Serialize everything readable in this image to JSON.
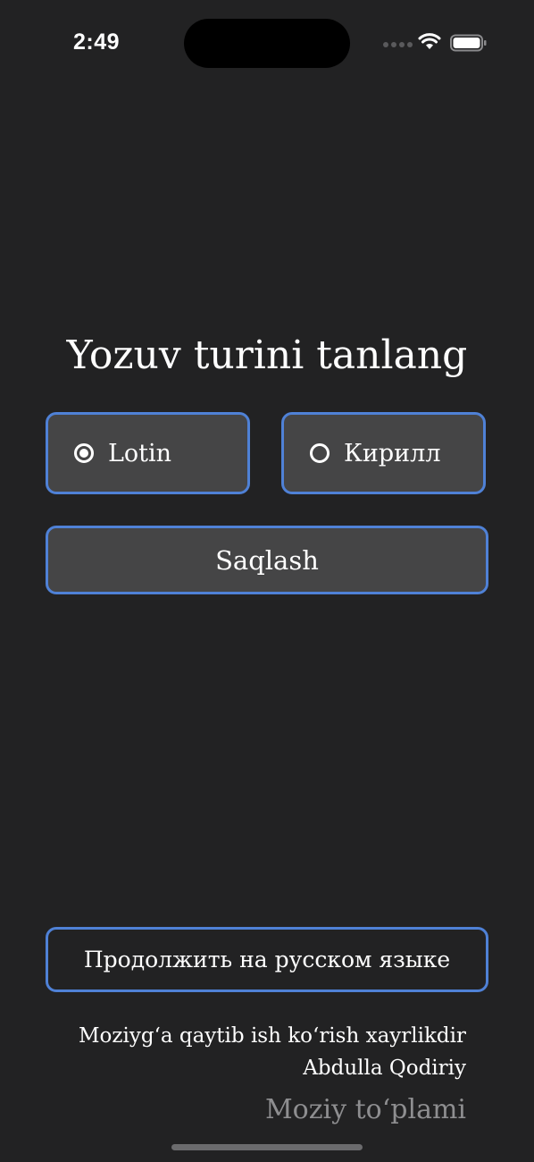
{
  "status_bar": {
    "time": "2:49"
  },
  "main": {
    "title": "Yozuv turini tanlang",
    "options": [
      {
        "label": "Lotin",
        "selected": true
      },
      {
        "label": "Кирилл",
        "selected": false
      }
    ],
    "save_label": "Saqlash"
  },
  "footer": {
    "russian_button_label": "Продолжить на русском языке",
    "quote_text": "Moziyg‘a qaytib ish ko‘rish xayrlikdir",
    "quote_author": "Abdulla Qodiriy",
    "app_name": "Moziy to‘plami"
  },
  "colors": {
    "background": "#222223",
    "card": "#454546",
    "accent_border": "#4f81d6",
    "muted_text": "#8e8e90"
  },
  "icons": {
    "signal": "cellular-signal-icon",
    "wifi": "wifi-icon",
    "battery": "battery-icon",
    "radio_on": "radio-checked-icon",
    "radio_off": "radio-unchecked-icon"
  }
}
